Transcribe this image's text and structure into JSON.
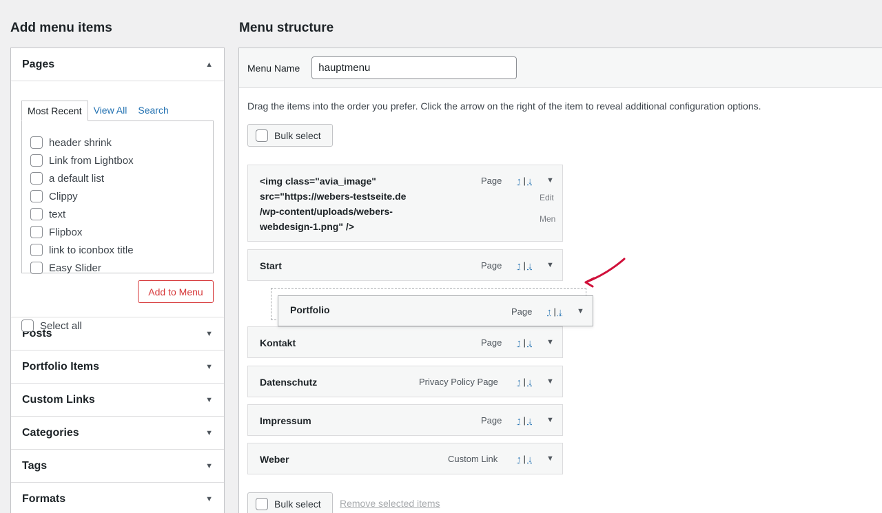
{
  "left": {
    "heading": "Add menu items",
    "pages": {
      "title": "Pages",
      "tabs": [
        "Most Recent",
        "View All",
        "Search"
      ],
      "items": [
        "header shrink",
        "Link from Lightbox",
        "a default list",
        "Clippy",
        "text",
        "Flipbox",
        "link to iconbox title",
        "Easy Slider"
      ],
      "select_all": "Select all",
      "add_button": "Add to Menu"
    },
    "sections": [
      "Posts",
      "Portfolio Items",
      "Custom Links",
      "Categories",
      "Tags",
      "Formats"
    ]
  },
  "right": {
    "heading": "Menu structure",
    "menu_name_label": "Menu Name",
    "menu_name_value": "hauptmenu",
    "instructions": "Drag the items into the order you prefer. Click the arrow on the right of the item to reveal additional configuration options.",
    "bulk_select": "Bulk select",
    "remove_selected": "Remove selected items",
    "first_item": {
      "lines": [
        "<img class=\"avia_image\"",
        "src=\"https://webers-testseite.de",
        "/wp-content/uploads/webers-",
        "webdesign-1.png\" />"
      ],
      "type": "Page",
      "edit": "Edit",
      "menu": "Men"
    },
    "items": [
      {
        "title": "Start",
        "type": "Page"
      },
      {
        "title": "Kontakt",
        "type": "Page"
      },
      {
        "title": "Datenschutz",
        "type": "Privacy Policy Page"
      },
      {
        "title": "Impressum",
        "type": "Page"
      },
      {
        "title": "Weber",
        "type": "Custom Link"
      }
    ],
    "dragging_item": {
      "title": "Portfolio",
      "type": "Page"
    },
    "move_up": "↑",
    "move_sep": "|",
    "move_down": "↓",
    "toggle_icon": "triangle-down-icon",
    "edit_cut": "Edit"
  },
  "colors": {
    "accent": "#2271b1",
    "danger": "#d63638",
    "annotation": "#d0103a"
  }
}
